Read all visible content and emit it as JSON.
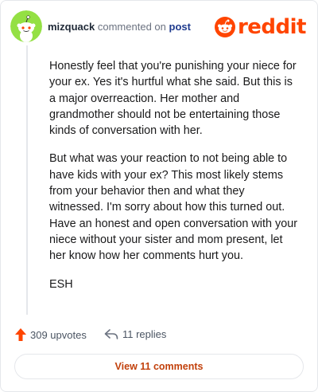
{
  "comment": {
    "username": "mizquack",
    "action_text": "commented on",
    "post_link": "post",
    "paragraphs": [
      "Honestly feel that you're punishing your niece for your ex. Yes it's hurtful what she said. But this is a major overreaction. Her mother and grandmother should not be entertaining those kinds of conversation with her.",
      "But what was your reaction to not being able to have kids with your ex? This most likely stems from your behavior then and what they witnessed. I'm sorry about how this turned out. Have an honest and open conversation with your niece without your sister and mom present, let her know how her comments hurt you.",
      "ESH"
    ]
  },
  "brand": {
    "wordmark": "reddit",
    "icon": "reddit-snoo-icon",
    "color": "#ff4500"
  },
  "avatar": {
    "icon": "snoo-avatar-icon",
    "background": "#94e044"
  },
  "stats": {
    "upvotes_label": "309 upvotes",
    "upvote_icon": "upvote-arrow-icon",
    "replies_label": "11 replies",
    "reply_icon": "reply-arrow-icon"
  },
  "view_button": {
    "label": "View 11 comments"
  }
}
